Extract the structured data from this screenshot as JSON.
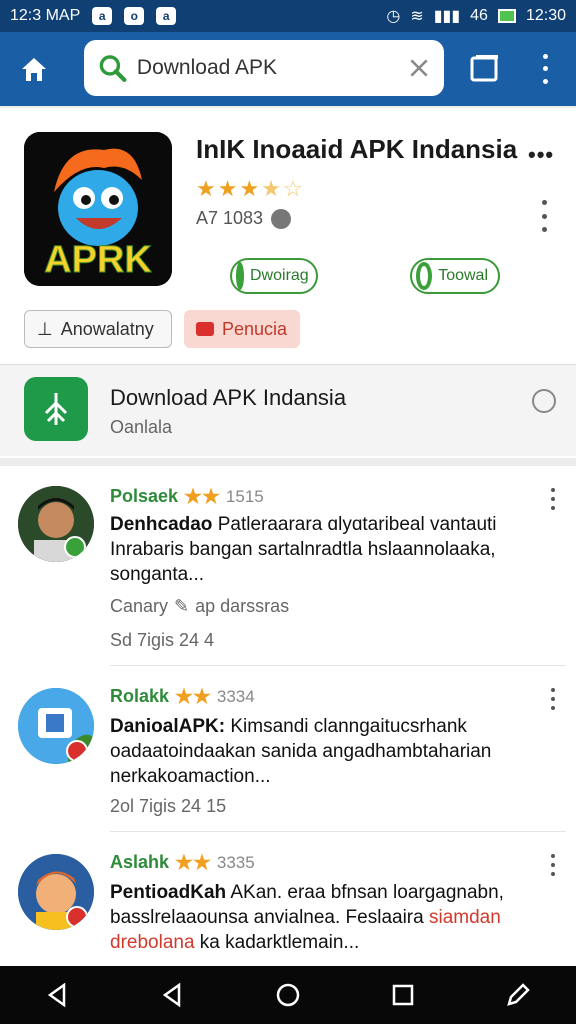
{
  "status_bar": {
    "left_text": "12:3 MAP",
    "notifications": [
      "a",
      "o",
      "a"
    ],
    "signal_text": "46",
    "time": "12:30"
  },
  "search": {
    "value": "Download APK",
    "placeholder": "Download APK"
  },
  "app": {
    "title": "InIK Inoaaid APK Indansia",
    "menu_label": "•••",
    "rating": 3.5,
    "downloads": "A7 1083",
    "icon_text": "APRK",
    "download_label": "Dwoirag",
    "follow_label": "Toowal",
    "about_label": "Anowalatny",
    "report_label": "Penucia"
  },
  "related": {
    "title": "Download APK Indansia",
    "subtitle": "Oanlala"
  },
  "reviews": [
    {
      "name": "Polsaek",
      "stars": "★★",
      "count": "1515",
      "text_bold": "Denhcadao",
      "text_rest": " Patleraarara ɑlyɑtaribeal vantauti Inrabaris bangan sartalnradtla hslaannolaaka, songanta...",
      "meta_label": "Canary",
      "meta_tag": "ap darssras",
      "date": "Sd 7igis 24 4"
    },
    {
      "name": "Rolakk",
      "stars": "★★",
      "count": "3334",
      "text_bold": "DanioalAPK:",
      "text_rest": " Kimsandi clanngaitucsrhank oadaatoindaakan sanida angadhambtaharian nerkakoamaction...",
      "meta_label": "",
      "meta_tag": "",
      "date": "2ol 7igis 24 15"
    },
    {
      "name": "Aslahk",
      "stars": "★★",
      "count": "3335",
      "text_bold": "PentioadKah",
      "text_rest": " AKan. eraa bfnsan loargagnabn, basslrelaaounsa anvialnea. Feslaaira",
      "text_red": "siamdan drebolana",
      "text_tail": " ka kadarktlemain...",
      "meta_label": "",
      "meta_tag": "",
      "date": ""
    }
  ],
  "colors": {
    "status_bar": "#0f3f73",
    "app_bar": "#1a5ea5",
    "accent_green": "#2e8b3a",
    "star": "#f0a020",
    "report_red": "#d23a2c"
  }
}
